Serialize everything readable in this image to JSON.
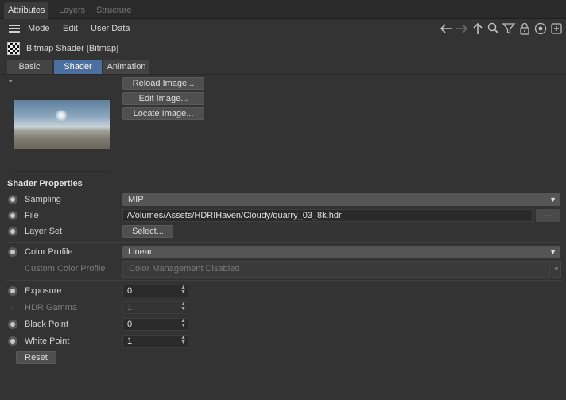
{
  "tabs": [
    {
      "label": "Attributes"
    },
    {
      "label": "Layers"
    },
    {
      "label": "Structure"
    }
  ],
  "menu": {
    "items": [
      "Mode",
      "Edit",
      "User Data"
    ]
  },
  "toolbar_icons": [
    "arrow-left-icon",
    "arrow-right-icon",
    "arrow-up-icon",
    "search-icon",
    "filter-icon",
    "lock-icon",
    "target-icon",
    "new-window-icon"
  ],
  "object": {
    "title": "Bitmap Shader [Bitmap]"
  },
  "subtabs": [
    "Basic",
    "Shader",
    "Animation"
  ],
  "preview": {
    "buttons": [
      "Reload Image...",
      "Edit Image...",
      "Locate Image..."
    ]
  },
  "shader_properties": {
    "title": "Shader Properties",
    "sampling": {
      "label": "Sampling",
      "value": "MIP"
    },
    "file": {
      "label": "File",
      "value": "/Volumes/Assets/HDRIHaven/Cloudy/quarry_03_8k.hdr",
      "browse": "..."
    },
    "layer_set": {
      "label": "Layer Set",
      "button": "Select..."
    },
    "color_profile": {
      "label": "Color Profile",
      "value": "Linear"
    },
    "custom_color_profile": {
      "label": "Custom Color Profile",
      "value": "Color Management Disabled"
    },
    "exposure": {
      "label": "Exposure",
      "value": "0"
    },
    "hdr_gamma": {
      "label": "HDR Gamma",
      "value": "1"
    },
    "black_point": {
      "label": "Black Point",
      "value": "0"
    },
    "white_point": {
      "label": "White Point",
      "value": "1"
    },
    "reset": "Reset"
  },
  "colors": {
    "background": "#333333",
    "accent": "#4a6fa0"
  }
}
